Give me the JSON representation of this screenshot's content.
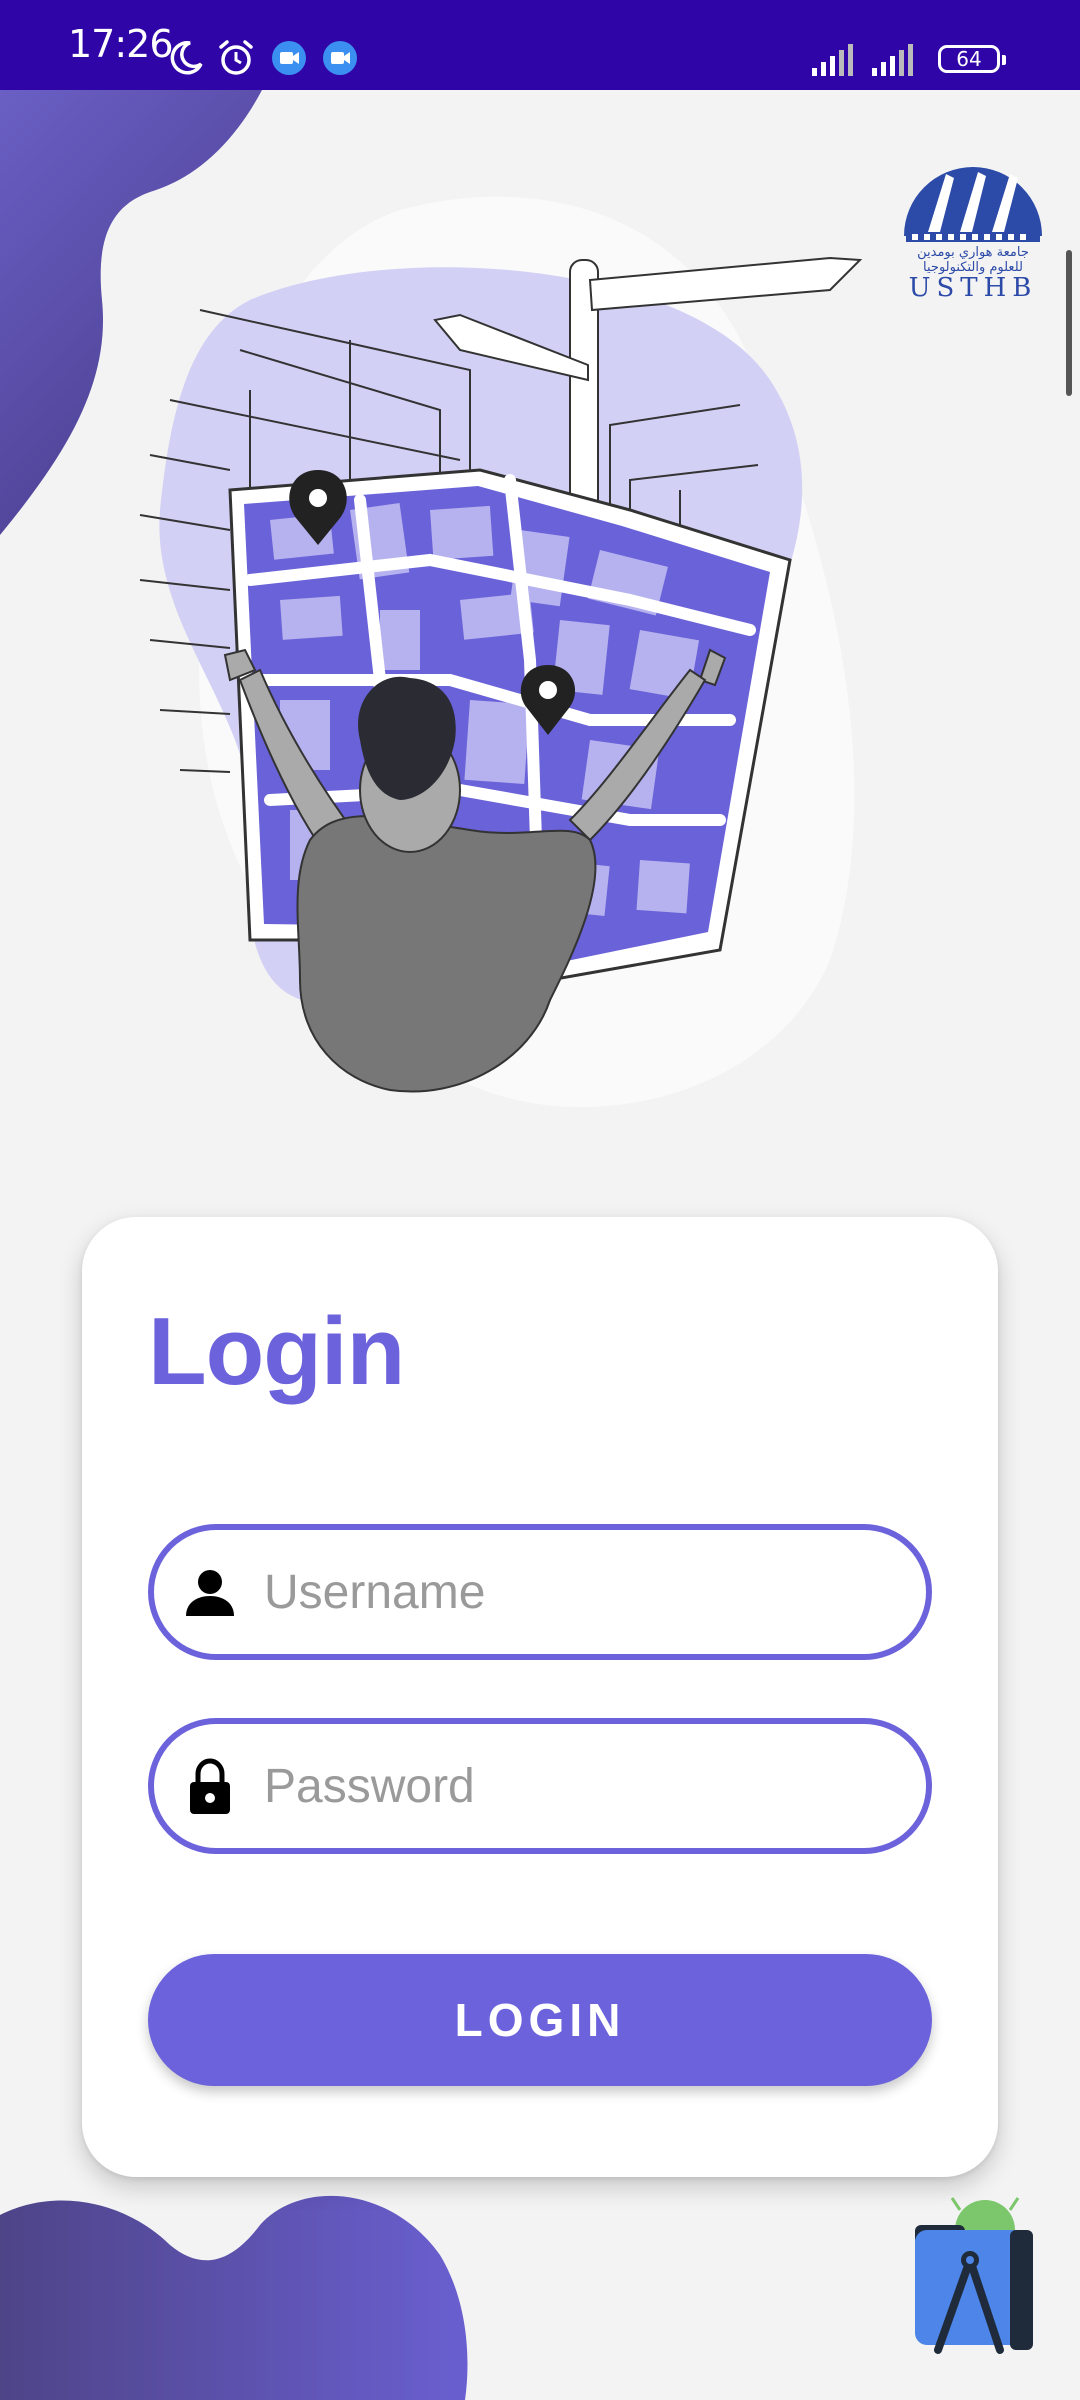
{
  "status_bar": {
    "time": "17:26",
    "battery": "64",
    "icons": [
      "moon-icon",
      "alarm-icon",
      "video-call-icon",
      "video-call-icon",
      "signal-icon",
      "signal-icon",
      "battery-icon"
    ]
  },
  "logo": {
    "arabic_line1": "جامعة هواري بومدين",
    "arabic_line2": "للعلوم والتكنولوجيا",
    "latin": "USTHB"
  },
  "login": {
    "title": "Login",
    "username_placeholder": "Username",
    "password_placeholder": "Password",
    "button_label": "LOGIN"
  },
  "colors": {
    "status_bar": "#2f05a8",
    "accent": "#6c63dc",
    "background": "#f3f3f3"
  }
}
